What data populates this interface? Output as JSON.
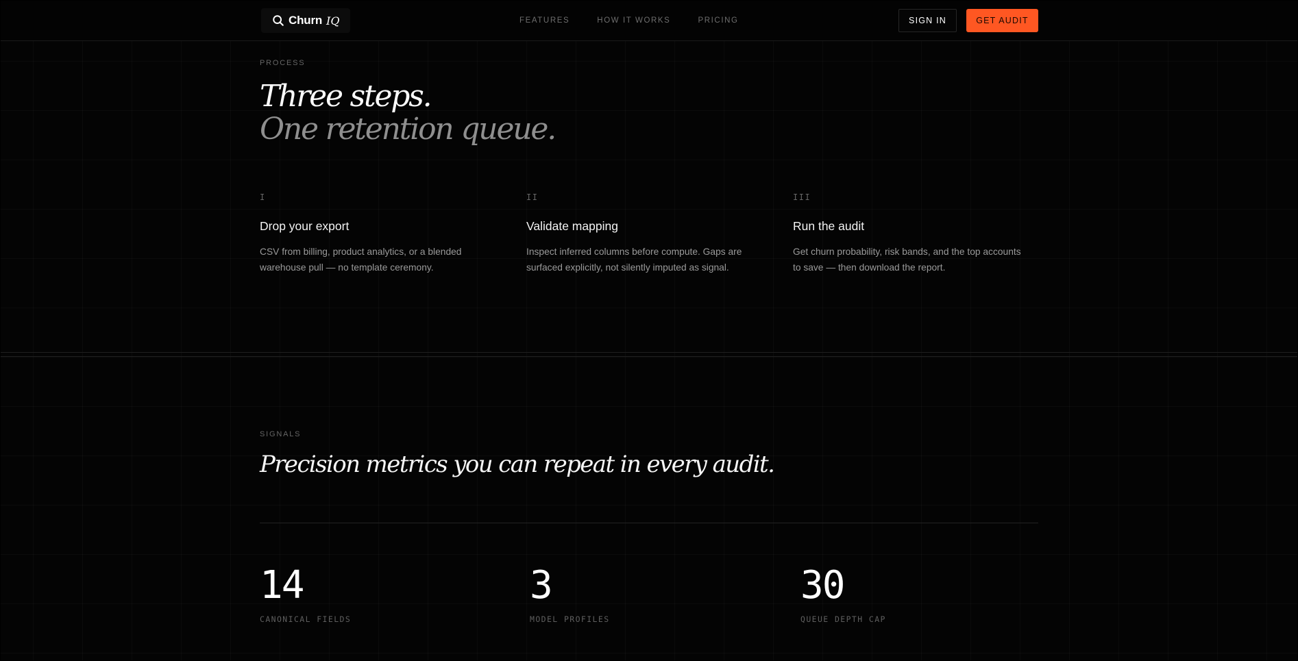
{
  "header": {
    "brand": {
      "name": "Churn",
      "accent": "IQ",
      "icon": "magnifier-logo-icon"
    },
    "nav": [
      {
        "label": "FEATURES"
      },
      {
        "label": "HOW IT WORKS"
      },
      {
        "label": "PRICING"
      }
    ],
    "sign_in_label": "SIGN IN",
    "cta_label": "GET AUDIT"
  },
  "process": {
    "eyebrow": "PROCESS",
    "headline_line1": "Three steps.",
    "headline_line2": "One retention queue.",
    "steps": [
      {
        "number": "I",
        "title": "Drop your export",
        "description": "CSV from billing, product analytics, or a blended warehouse pull — no template ceremony."
      },
      {
        "number": "II",
        "title": "Validate mapping",
        "description": "Inspect inferred columns before compute. Gaps are surfaced explicitly, not silently imputed as signal."
      },
      {
        "number": "III",
        "title": "Run the audit",
        "description": "Get churn probability, risk bands, and the top accounts to save — then download the report."
      }
    ]
  },
  "signals": {
    "eyebrow": "SIGNALS",
    "headline": "Precision metrics you can repeat in every audit.",
    "stats": [
      {
        "value": "14",
        "label": "CANONICAL FIELDS"
      },
      {
        "value": "3",
        "label": "MODEL PROFILES"
      },
      {
        "value": "30",
        "label": "QUEUE DEPTH CAP"
      }
    ]
  },
  "colors": {
    "background": "#040404",
    "accent": "#ff5722",
    "text_primary": "#f3f3f3",
    "text_muted": "#9a9a9a"
  }
}
